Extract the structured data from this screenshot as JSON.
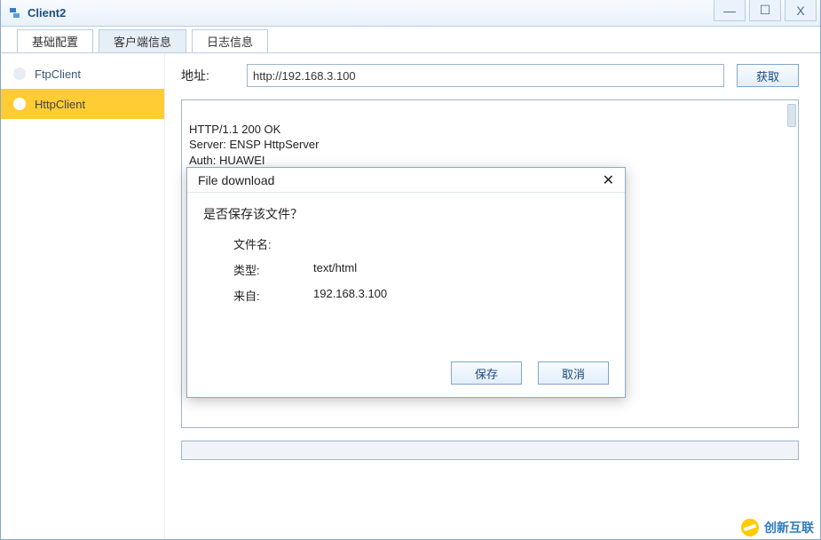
{
  "window": {
    "title": "Client2",
    "min_glyph": "—",
    "max_glyph": "☐",
    "close_glyph": "X"
  },
  "tabs": [
    {
      "label": "基础配置"
    },
    {
      "label": "客户端信息"
    },
    {
      "label": "日志信息"
    }
  ],
  "sidebar": {
    "items": [
      {
        "label": "FtpClient"
      },
      {
        "label": "HttpClient"
      }
    ]
  },
  "content": {
    "address_label": "地址:",
    "address_value": "http://192.168.3.100",
    "fetch_button": "获取",
    "response_text": "HTTP/1.1 200 OK\nServer: ENSP HttpServer\nAuth: HUAWEI"
  },
  "dialog": {
    "title": "File download",
    "question": "是否保存该文件？",
    "filename_label": "文件名:",
    "filename_value": "",
    "type_label": "类型:",
    "type_value": "text/html",
    "from_label": "来自:",
    "from_value": "192.168.3.100",
    "save_label": "保存",
    "cancel_label": "取消"
  },
  "watermark": {
    "text": "创新互联"
  }
}
